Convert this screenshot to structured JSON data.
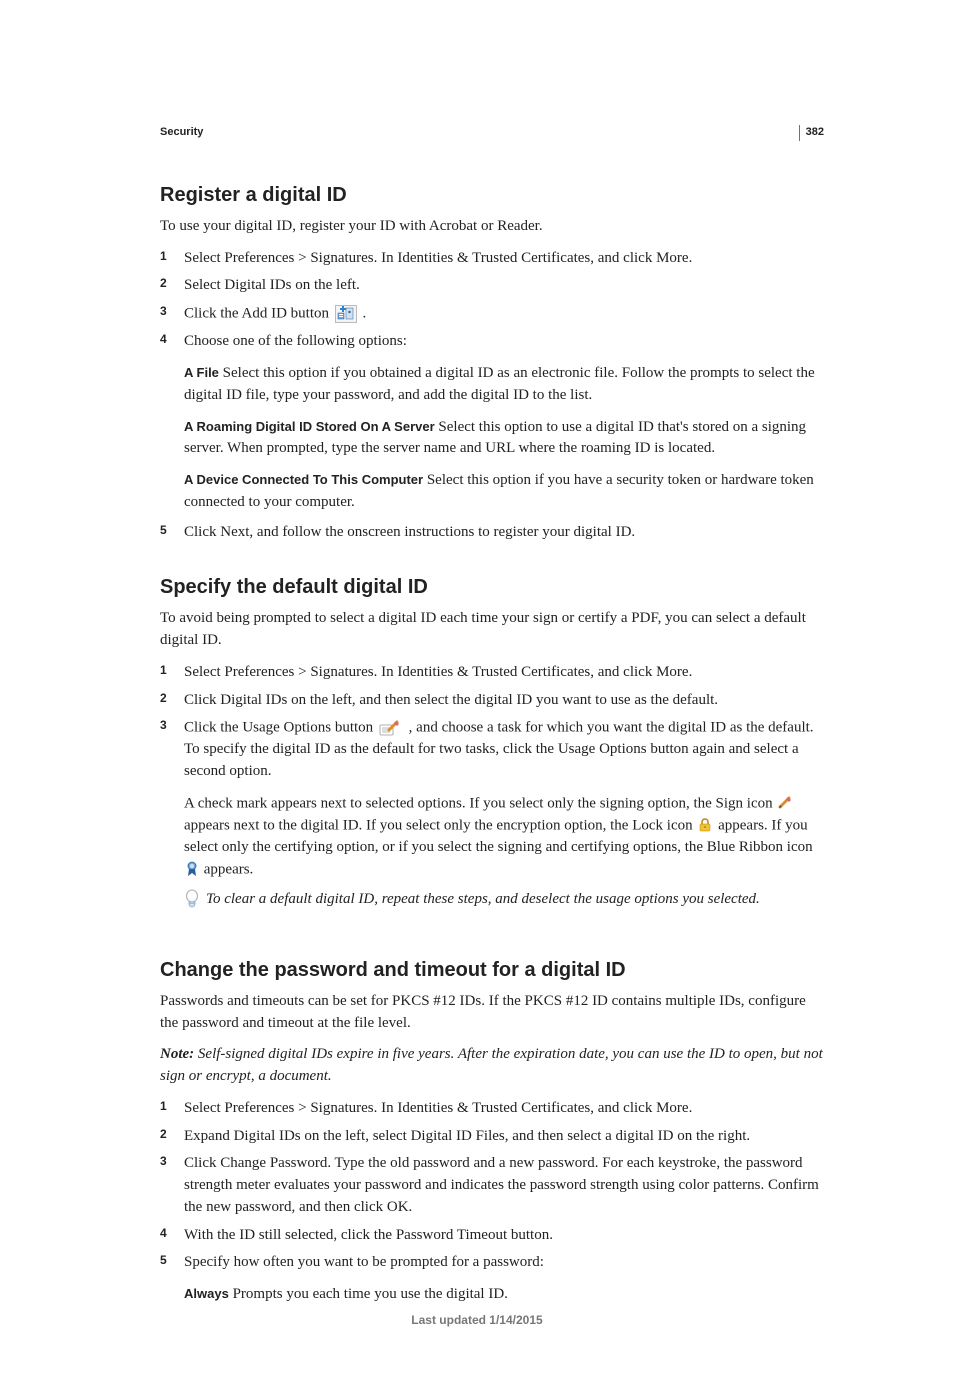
{
  "page_number": "382",
  "section_label": "Security",
  "footer": "Last updated 1/14/2015",
  "s1": {
    "heading": "Register a digital ID",
    "intro": "To use your digital ID, register your ID with Acrobat or Reader.",
    "step1": "Select Preferences > Signatures. In Identities & Trusted Certificates, and click More.",
    "step2": "Select Digital IDs on the left.",
    "step3_a": "Click the Add ID button ",
    "step3_b": " .",
    "step4": "Choose one of the following options:",
    "opt_a_label": "A File",
    "opt_a_text": "  Select this option if you obtained a digital ID as an electronic file. Follow the prompts to select the digital ID file, type your password, and add the digital ID to the list.",
    "opt_b_label": "A Roaming Digital ID Stored On A Server",
    "opt_b_text": "  Select this option to use a digital ID that's stored on a signing server. When prompted, type the server name and URL where the roaming ID is located.",
    "opt_c_label": "A Device Connected To This Computer",
    "opt_c_text": "  Select this option if you have a security token or hardware token connected to your computer.",
    "step5": "Click Next, and follow the onscreen instructions to register your digital ID."
  },
  "s2": {
    "heading": "Specify the default digital ID",
    "intro": "To avoid being prompted to select a digital ID each time your sign or certify a PDF, you can select a default digital ID.",
    "step1": "Select Preferences > Signatures. In Identities & Trusted Certificates, and click More.",
    "step2": "Click Digital IDs on the left, and then select the digital ID you want to use as the default.",
    "step3_a": "Click the Usage Options button ",
    "step3_b": " , and choose a task for which you want the digital ID as the default. To specify the digital ID as the default for two tasks, click the Usage Options button again and select a second option.",
    "result_a": "A check mark appears next to selected options. If you select only the signing option, the Sign icon ",
    "result_b": " appears next to the digital ID. If you select only the encryption option, the Lock icon ",
    "result_c": " appears. If you select only the certifying option, or if you select the signing and certifying options, the Blue Ribbon icon ",
    "result_d": " appears.",
    "tip": "To clear a default digital ID, repeat these steps, and deselect the usage options you selected."
  },
  "s3": {
    "heading": "Change the password and timeout for a digital ID",
    "intro": "Passwords and timeouts can be set for PKCS #12 IDs. If the PKCS #12 ID contains multiple IDs, configure the password and timeout at the file level.",
    "note_label": "Note:",
    "note_text": " Self-signed digital IDs expire in five years. After the expiration date, you can use the ID to open, but not sign or encrypt, a document.",
    "step1": "Select Preferences > Signatures. In Identities & Trusted Certificates, and click More.",
    "step2": "Expand Digital IDs on the left, select Digital ID Files, and then select a digital ID on the right.",
    "step3": "Click Change Password. Type the old password and a new password. For each keystroke, the password strength meter evaluates your password and indicates the password strength using color patterns. Confirm the new password, and then click OK.",
    "step4": "With the ID still selected, click the Password Timeout button.",
    "step5": "Specify how often you want to be prompted for a password:",
    "opt_a_label": "Always",
    "opt_a_text": "  Prompts you each time you use the digital ID."
  }
}
